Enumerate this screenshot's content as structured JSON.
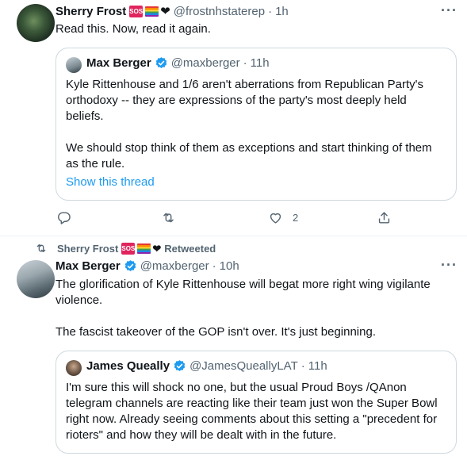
{
  "tweet1": {
    "author_name": "Sherry Frost",
    "badge_sos": "SOS",
    "handle": "@frostnhstaterep",
    "time": "1h",
    "text": "Read this.  Now, read it again.",
    "quote": {
      "author_name": "Max Berger",
      "handle": "@maxberger",
      "time": "11h",
      "paragraph1": "Kyle Rittenhouse and 1/6 aren't aberrations from Republican Party's orthodoxy -- they are expressions of the party's most deeply held beliefs.",
      "paragraph2": "We should stop think of them as exceptions and start thinking of them as the rule.",
      "show_thread": "Show this thread"
    },
    "actions": {
      "reply_icon": "reply-icon",
      "retweet_icon": "retweet-icon",
      "like_icon": "heart-icon",
      "like_count": "2",
      "share_icon": "share-icon"
    }
  },
  "retweet_banner": {
    "retweeter": "Sherry Frost",
    "badge_sos": "SOS",
    "label": "Retweeted"
  },
  "tweet2": {
    "author_name": "Max Berger",
    "handle": "@maxberger",
    "time": "10h",
    "paragraph1": "The glorification of Kyle Rittenhouse will begat more right wing vigilante violence.",
    "paragraph2": "The fascist takeover of the GOP isn't over. It's just beginning.",
    "quote": {
      "author_name": "James Queally",
      "handle": "@JamesQueallyLAT",
      "time": "11h",
      "text": "I'm sure this will shock no one, but the usual Proud Boys /QAnon telegram channels are reacting like their team just won the Super Bowl right now. Already seeing comments about this setting a \"precedent for rioters\" and how they will be dealt with in the future."
    }
  },
  "separator": "·",
  "colors": {
    "text": "#0f1419",
    "secondary": "#536471",
    "accent": "#1d9bf0",
    "border": "#cfd9de"
  }
}
